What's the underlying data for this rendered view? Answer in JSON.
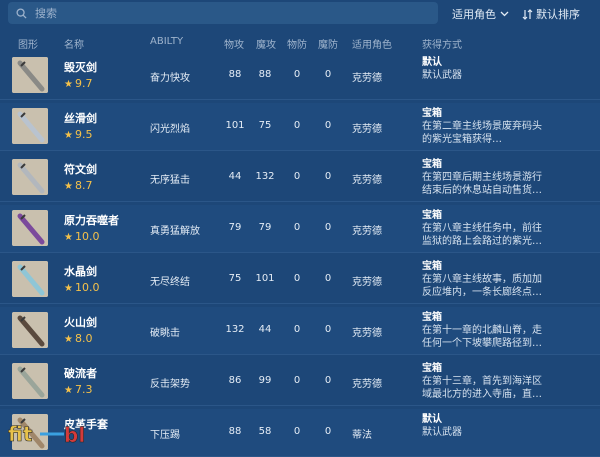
{
  "search": {
    "placeholder": "搜索"
  },
  "filter": {
    "label": "适用角色"
  },
  "sort": {
    "label": "默认排序"
  },
  "columns": [
    "图形",
    "名称",
    "ABILTY",
    "物攻",
    "魔攻",
    "物防",
    "魔防",
    "适用角色",
    "获得方式"
  ],
  "weapons": [
    {
      "name": "毁灭剑",
      "rating": "9.7",
      "ability": "奋力快攻",
      "patk": "88",
      "matk": "88",
      "pdef": "0",
      "mdef": "0",
      "char": "克劳德",
      "acq_type": "默认",
      "acq_desc": "默认武器",
      "thumb_color": "#8a8a86"
    },
    {
      "name": "丝滑剑",
      "rating": "9.5",
      "ability": "闪光烈焰",
      "patk": "101",
      "matk": "75",
      "pdef": "0",
      "mdef": "0",
      "char": "克劳德",
      "acq_type": "宝箱",
      "acq_desc": "在第二章主线场景废弃码头的紫光宝箱获得…",
      "thumb_color": "#b9c3cf"
    },
    {
      "name": "符文剑",
      "rating": "8.7",
      "ability": "无序猛击",
      "patk": "44",
      "matk": "132",
      "pdef": "0",
      "mdef": "0",
      "char": "克劳德",
      "acq_type": "宝箱",
      "acq_desc": "在第四章后期主线场景游行结束后的休息站自动售货…",
      "thumb_color": "#b2b7bd"
    },
    {
      "name": "原力吞噬者",
      "rating": "10.0",
      "ability": "真勇猛解放",
      "patk": "79",
      "matk": "79",
      "pdef": "0",
      "mdef": "0",
      "char": "克劳德",
      "acq_type": "宝箱",
      "acq_desc": "在第八章主线任务中，前往监狱的路上会路过的紫光…",
      "thumb_color": "#7b4a9c"
    },
    {
      "name": "水晶剑",
      "rating": "10.0",
      "ability": "无尽终结",
      "patk": "75",
      "matk": "101",
      "pdef": "0",
      "mdef": "0",
      "char": "克劳德",
      "acq_type": "宝箱",
      "acq_desc": "在第八章主线故事，质加加反应堆内，一条长廊终点…",
      "thumb_color": "#8fc6d6"
    },
    {
      "name": "火山剑",
      "rating": "8.0",
      "ability": "破眺击",
      "patk": "132",
      "matk": "44",
      "pdef": "0",
      "mdef": "0",
      "char": "克劳德",
      "acq_type": "宝箱",
      "acq_desc": "在第十一章的北麟山脊，走任何一个下坡攀爬路径到…",
      "thumb_color": "#5a4a3e"
    },
    {
      "name": "破流者",
      "rating": "7.3",
      "ability": "反击架势",
      "patk": "86",
      "matk": "99",
      "pdef": "0",
      "mdef": "0",
      "char": "克劳德",
      "acq_type": "宝箱",
      "acq_desc": "在第十三章，首先到海洋区域最北方的进入寺庙，直…",
      "thumb_color": "#9aa59a"
    },
    {
      "name": "皮革手套",
      "rating": "",
      "ability": "下压踢",
      "patk": "88",
      "matk": "58",
      "pdef": "0",
      "mdef": "0",
      "char": "蒂法",
      "acq_type": "默认",
      "acq_desc": "默认武器",
      "thumb_color": "#a0876a"
    }
  ],
  "watermark": "fit 3DM"
}
